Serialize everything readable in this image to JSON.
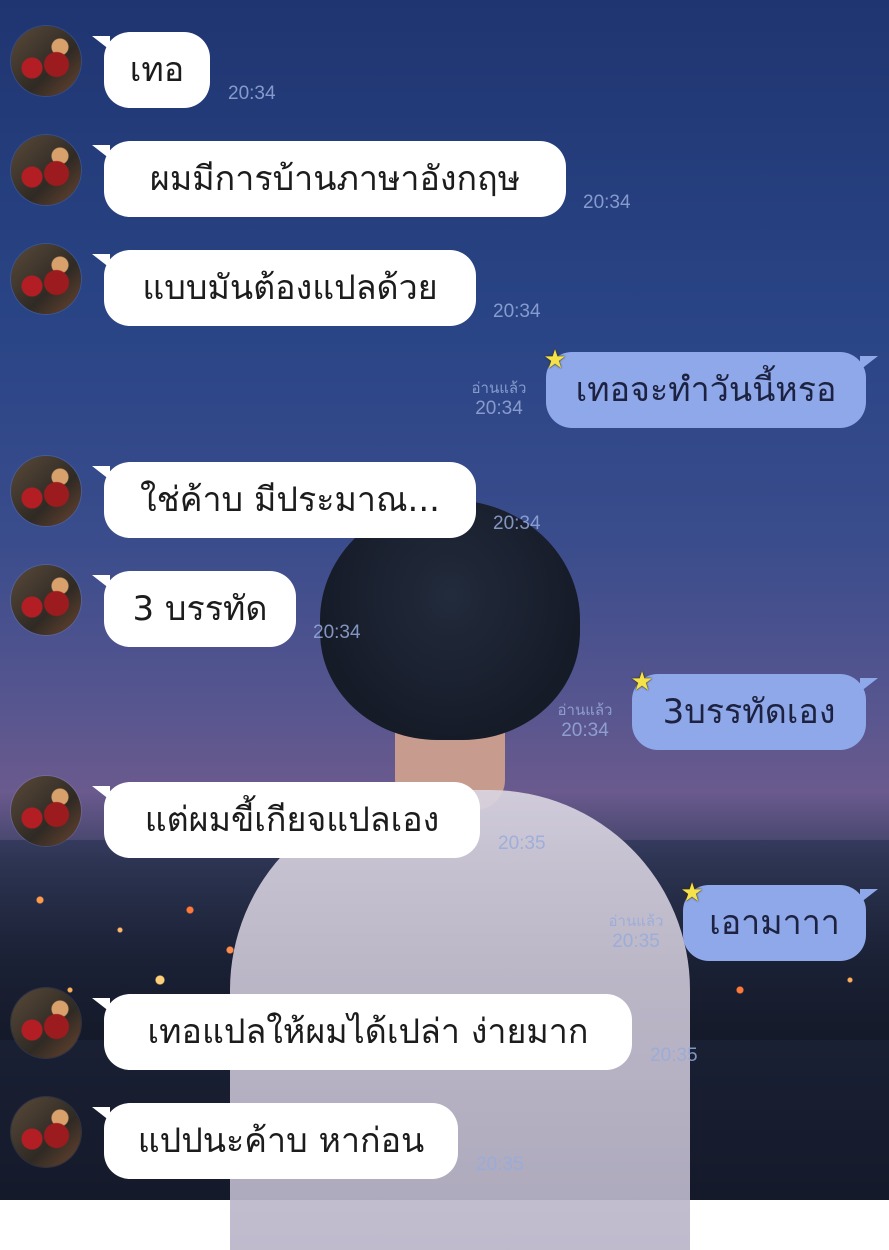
{
  "messages": [
    {
      "side": "left",
      "text": "เทอ",
      "time": "20:34"
    },
    {
      "side": "left",
      "text": "ผมมีการบ้านภาษาอังกฤษ",
      "time": "20:34"
    },
    {
      "side": "left",
      "text": "แบบมันต้องแปลด้วย",
      "time": "20:34"
    },
    {
      "side": "right",
      "text": "เทอจะทำวันนี้หรอ",
      "read": "อ่านแล้ว",
      "time": "20:34"
    },
    {
      "side": "left",
      "text": "ใช่ค้าบ มีประมาณ...",
      "time": "20:34"
    },
    {
      "side": "left",
      "text": "3 บรรทัด",
      "time": "20:34"
    },
    {
      "side": "right",
      "text": "3บรรทัดเอง",
      "read": "อ่านแล้ว",
      "time": "20:34"
    },
    {
      "side": "left",
      "text": "แต่ผมขี้เกียจแปลเอง",
      "time": "20:35"
    },
    {
      "side": "right",
      "text": "เอามาาา",
      "read": "อ่านแล้ว",
      "time": "20:35"
    },
    {
      "side": "left",
      "text": "เทอแปลให้ผมได้เปล่า ง่ายมาก",
      "time": "20:35"
    },
    {
      "side": "left",
      "text": "แปปนะค้าบ หาก่อน",
      "time": "20:35"
    }
  ],
  "icons": {
    "avatar": "friend-avatar-photo",
    "star": "star-sticker-icon"
  },
  "colors": {
    "incoming_bubble": "#ffffff",
    "outgoing_bubble": "#8fa8ea",
    "timestamp": "#96aadc"
  }
}
